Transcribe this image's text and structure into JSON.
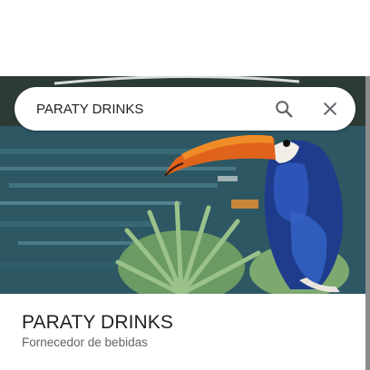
{
  "search": {
    "query": "PARATY DRINKS",
    "search_icon": "search-icon",
    "close_icon": "close-icon"
  },
  "hero": {
    "description_icon": "place-photo"
  },
  "place": {
    "name": "PARATY DRINKS",
    "category": "Fornecedor de bebidas"
  },
  "colors": {
    "text_primary": "#202124",
    "text_secondary": "#5f6368",
    "icon": "#5f6368"
  }
}
